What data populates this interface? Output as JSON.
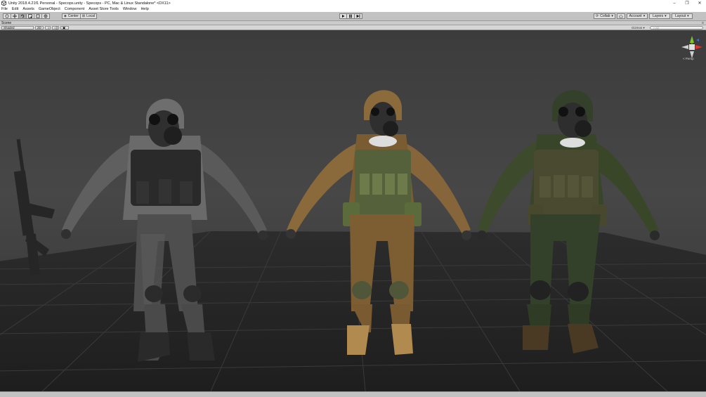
{
  "window": {
    "title": "Unity 2018.4.21f1 Personal - Specops.unity - Specops - PC, Mac & Linux Standalone* <DX11>",
    "controls": {
      "minimize": "–",
      "maximize": "❐",
      "close": "✕"
    }
  },
  "menu": {
    "items": [
      "File",
      "Edit",
      "Assets",
      "GameObject",
      "Component",
      "Asset Store Tools",
      "Window",
      "Help"
    ]
  },
  "toolbar": {
    "tools": [
      "hand-tool-icon",
      "move-tool-icon",
      "rotate-tool-icon",
      "scale-tool-icon",
      "rect-tool-icon",
      "transform-tool-icon"
    ],
    "pivot_mode": "Center",
    "pivot_rotation": "Local",
    "collab": "Collab",
    "account": "Account",
    "layers": "Layers",
    "layout": "Layout"
  },
  "scene_panel": {
    "tab_label": "Scene",
    "shading_mode": "Shaded",
    "mode_2d": "2D",
    "gizmos": "Gizmos",
    "search_placeholder": "All",
    "persp_label": "< Persp"
  },
  "colors": {
    "toolbar_bg": "#c2c2c2",
    "viewport_bg": "#474747",
    "camo_grey": "#5a5a5a",
    "camo_desert": "#8a6a3a",
    "camo_woodland": "#3e4a2c"
  }
}
